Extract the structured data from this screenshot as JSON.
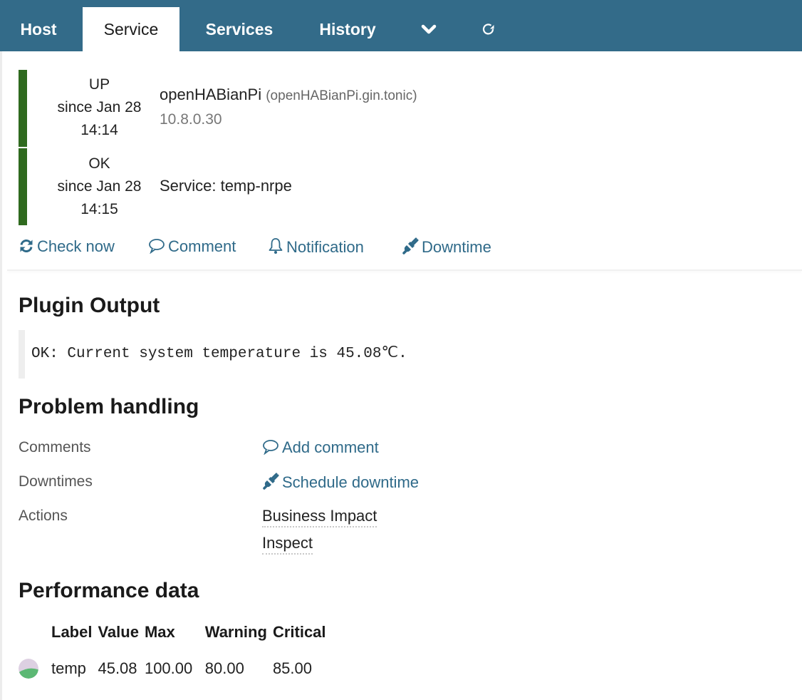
{
  "tabs": [
    {
      "label": "Host",
      "active": false
    },
    {
      "label": "Service",
      "active": true
    },
    {
      "label": "Services",
      "active": false
    },
    {
      "label": "History",
      "active": false
    }
  ],
  "tab_icons": {
    "more": "chevron-down-icon",
    "refresh": "refresh-icon"
  },
  "colors": {
    "tabbar": "#336b89",
    "link": "#2f6a89",
    "state_ok": "#2f6a1f",
    "pie_used": "#5cb874",
    "pie_free": "#ddd0e2"
  },
  "host": {
    "state": "UP",
    "since": "since Jan 28",
    "time": "14:14",
    "name": "openHABianPi",
    "fqdn": "(openHABianPi.gin.tonic)",
    "address": "10.8.0.30"
  },
  "service": {
    "state": "OK",
    "since": "since Jan 28",
    "time": "14:15",
    "name": "Service: temp-nrpe"
  },
  "quick_actions": [
    {
      "label": "Check now",
      "icon": "refresh-icon"
    },
    {
      "label": "Comment",
      "icon": "comment-icon"
    },
    {
      "label": "Notification",
      "icon": "bell-icon"
    },
    {
      "label": "Downtime",
      "icon": "plug-icon"
    }
  ],
  "plugin_output": {
    "title": "Plugin Output",
    "text": "OK: Current system temperature is 45.08℃."
  },
  "problem_handling": {
    "title": "Problem handling",
    "comments_label": "Comments",
    "add_comment": "Add comment",
    "downtimes_label": "Downtimes",
    "schedule_downtime": "Schedule downtime",
    "actions_label": "Actions",
    "actions": [
      "Business Impact",
      "Inspect"
    ]
  },
  "performance": {
    "title": "Performance data",
    "headers": [
      "Label",
      "Value",
      "Max",
      "Warning",
      "Critical"
    ],
    "rows": [
      {
        "label": "temp",
        "value": "45.08",
        "max": "100.00",
        "warning": "80.00",
        "critical": "85.00",
        "fill_fraction": 0.4508
      }
    ]
  }
}
